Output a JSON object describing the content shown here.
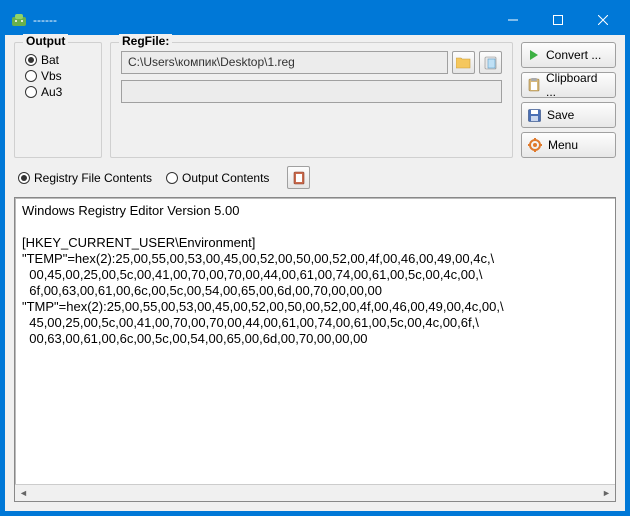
{
  "window": {
    "title": "------"
  },
  "output": {
    "group_label": "Output",
    "options": [
      {
        "label": "Bat",
        "checked": true
      },
      {
        "label": "Vbs",
        "checked": false
      },
      {
        "label": "Au3",
        "checked": false
      }
    ]
  },
  "regfile": {
    "group_label": "RegFile:",
    "path": "C:\\Users\\компик\\Desktop\\1.reg"
  },
  "side_buttons": {
    "convert": "Convert ...",
    "clipboard": "Clipboard ...",
    "save": "Save",
    "menu": "Menu"
  },
  "view_toggle": {
    "registry": "Registry File Contents",
    "output": "Output Contents",
    "selected": "registry"
  },
  "editor_text": "Windows Registry Editor Version 5.00\n\n[HKEY_CURRENT_USER\\Environment]\n\"TEMP\"=hex(2):25,00,55,00,53,00,45,00,52,00,50,00,52,00,4f,00,46,00,49,00,4c,\\\n  00,45,00,25,00,5c,00,41,00,70,00,70,00,44,00,61,00,74,00,61,00,5c,00,4c,00,\\\n  6f,00,63,00,61,00,6c,00,5c,00,54,00,65,00,6d,00,70,00,00,00\n\"TMP\"=hex(2):25,00,55,00,53,00,45,00,52,00,50,00,52,00,4f,00,46,00,49,00,4c,00,\\\n  45,00,25,00,5c,00,41,00,70,00,70,00,44,00,61,00,74,00,61,00,5c,00,4c,00,6f,\\\n  00,63,00,61,00,6c,00,5c,00,54,00,65,00,6d,00,70,00,00,00"
}
